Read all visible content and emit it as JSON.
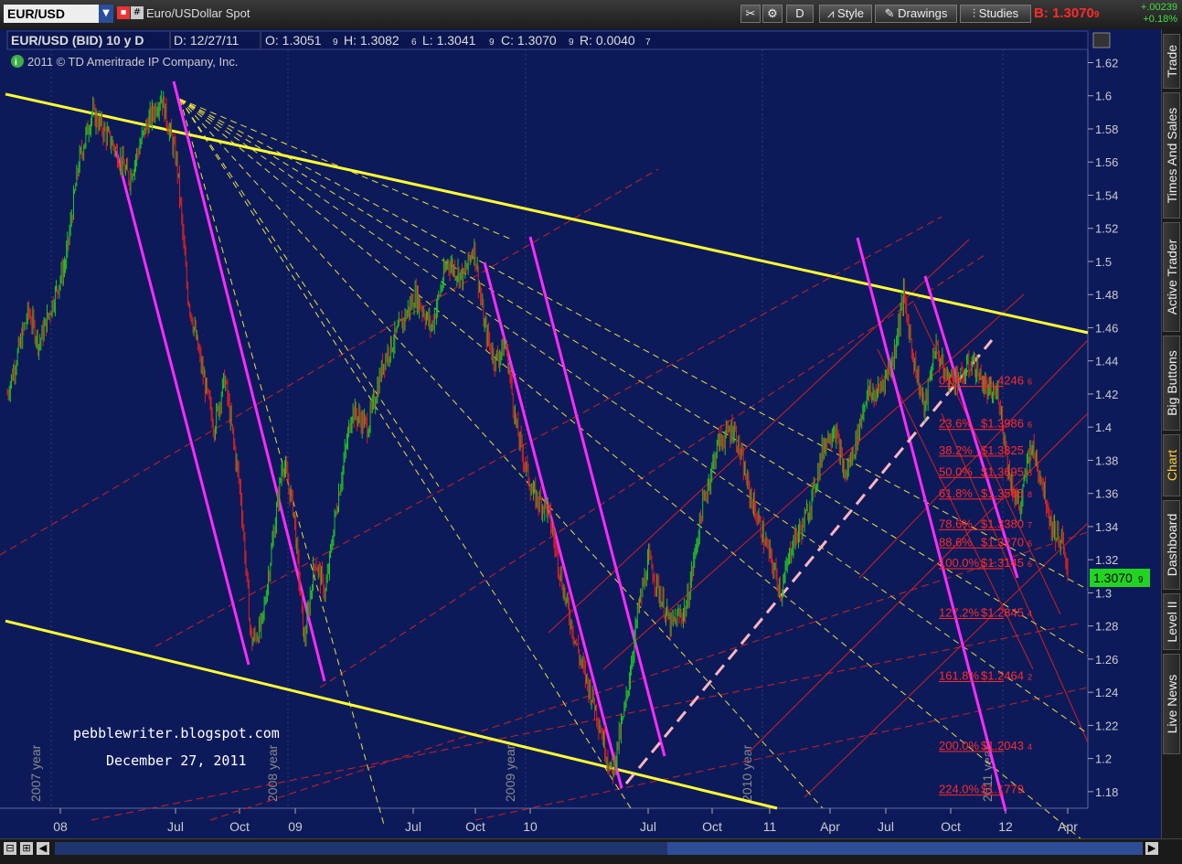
{
  "toolbar": {
    "symbol": "EUR/USD",
    "description": "Euro/USDollar Spot",
    "period_button": "D",
    "style_button": "Style",
    "drawings_button": "Drawings",
    "studies_button": "Studies",
    "bid_label": "B: 1.3070",
    "bid_last_digit": "9",
    "change": "+.00239",
    "change_pct": "+0.18%"
  },
  "header": {
    "instrument": "EUR/USD (BID) 10 y D",
    "date": "D: 12/27/11",
    "open": "O: 1.3051",
    "open_d": "9",
    "high": "H: 1.3082",
    "high_d": "6",
    "low": "L: 1.3041",
    "low_d": "9",
    "close": "C: 1.3070",
    "close_d": "9",
    "range": "R: 0.0040",
    "range_d": "7",
    "copyright": "2011 © TD Ameritrade IP Company, Inc."
  },
  "annotations": {
    "blog": "pebblewriter.blogspot.com",
    "date": "December 27, 2011"
  },
  "sidebar": {
    "tabs": [
      "Trade",
      "Times And Sales",
      "Active Trader",
      "Big Buttons",
      "Chart",
      "Dashboard",
      "Level II",
      "Live News"
    ],
    "active": "Chart"
  },
  "chart_data": {
    "type": "candlestick",
    "title": "EUR/USD (BID) 10 y D",
    "y_ticks": [
      1.18,
      1.2,
      1.22,
      1.24,
      1.26,
      1.28,
      1.3,
      1.32,
      1.34,
      1.36,
      1.38,
      1.4,
      1.42,
      1.44,
      1.46,
      1.48,
      1.5,
      1.52,
      1.54,
      1.56,
      1.58,
      1.6,
      1.62
    ],
    "ylim": [
      1.17,
      1.628
    ],
    "x_labels": [
      "08",
      "Jul",
      "Oct",
      "09",
      "Jul",
      "Oct",
      "10",
      "Jul",
      "Oct",
      "11",
      "Apr",
      "Jul",
      "Oct",
      "12",
      "Apr"
    ],
    "year_markers": [
      "2007 year",
      "2008 year",
      "2009 year",
      "2010 year",
      "2011 year"
    ],
    "current_price": "1.3070",
    "current_price_d": "9",
    "price_path": [
      [
        0,
        1.42
      ],
      [
        0.08,
        1.47
      ],
      [
        0.12,
        1.45
      ],
      [
        0.18,
        1.48
      ],
      [
        0.22,
        1.5
      ],
      [
        0.27,
        1.56
      ],
      [
        0.32,
        1.59
      ],
      [
        0.4,
        1.57
      ],
      [
        0.46,
        1.55
      ],
      [
        0.52,
        1.58
      ],
      [
        0.58,
        1.6
      ],
      [
        0.64,
        1.56
      ],
      [
        0.68,
        1.48
      ],
      [
        0.74,
        1.43
      ],
      [
        0.78,
        1.4
      ],
      [
        0.82,
        1.43
      ],
      [
        0.88,
        1.36
      ],
      [
        0.92,
        1.27
      ],
      [
        0.96,
        1.28
      ],
      [
        1.0,
        1.33
      ],
      [
        1.04,
        1.38
      ],
      [
        1.08,
        1.35
      ],
      [
        1.12,
        1.27
      ],
      [
        1.16,
        1.32
      ],
      [
        1.2,
        1.3
      ],
      [
        1.24,
        1.35
      ],
      [
        1.3,
        1.41
      ],
      [
        1.36,
        1.4
      ],
      [
        1.42,
        1.44
      ],
      [
        1.48,
        1.46
      ],
      [
        1.54,
        1.48
      ],
      [
        1.6,
        1.46
      ],
      [
        1.66,
        1.5
      ],
      [
        1.72,
        1.49
      ],
      [
        1.76,
        1.51
      ],
      [
        1.8,
        1.46
      ],
      [
        1.84,
        1.44
      ],
      [
        1.88,
        1.45
      ],
      [
        1.92,
        1.4
      ],
      [
        1.98,
        1.36
      ],
      [
        2.04,
        1.35
      ],
      [
        2.1,
        1.3
      ],
      [
        2.16,
        1.26
      ],
      [
        2.22,
        1.23
      ],
      [
        2.28,
        1.19
      ],
      [
        2.33,
        1.23
      ],
      [
        2.38,
        1.29
      ],
      [
        2.42,
        1.32
      ],
      [
        2.46,
        1.3
      ],
      [
        2.5,
        1.28
      ],
      [
        2.56,
        1.29
      ],
      [
        2.62,
        1.35
      ],
      [
        2.68,
        1.39
      ],
      [
        2.74,
        1.4
      ],
      [
        2.8,
        1.36
      ],
      [
        2.86,
        1.33
      ],
      [
        2.92,
        1.3
      ],
      [
        2.96,
        1.33
      ],
      [
        3.0,
        1.34
      ],
      [
        3.04,
        1.36
      ],
      [
        3.08,
        1.39
      ],
      [
        3.12,
        1.4
      ],
      [
        3.16,
        1.37
      ],
      [
        3.2,
        1.39
      ],
      [
        3.24,
        1.42
      ],
      [
        3.28,
        1.42
      ],
      [
        3.34,
        1.44
      ],
      [
        3.38,
        1.48
      ],
      [
        3.42,
        1.44
      ],
      [
        3.46,
        1.41
      ],
      [
        3.5,
        1.45
      ],
      [
        3.54,
        1.43
      ],
      [
        3.6,
        1.43
      ],
      [
        3.64,
        1.44
      ],
      [
        3.7,
        1.42
      ],
      [
        3.74,
        1.42
      ],
      [
        3.78,
        1.37
      ],
      [
        3.82,
        1.35
      ],
      [
        3.86,
        1.39
      ],
      [
        3.9,
        1.37
      ],
      [
        3.94,
        1.34
      ],
      [
        3.98,
        1.33
      ],
      [
        4.0,
        1.307
      ]
    ],
    "fibonacci": [
      {
        "pct": "0.0%",
        "price": "$1.4246",
        "d": "6",
        "value": 1.4246
      },
      {
        "pct": "23.6%",
        "price": "$1.3986",
        "d": "6",
        "value": 1.3986
      },
      {
        "pct": "38.2%",
        "price": "$1.3825",
        "d": "5",
        "value": 1.3825
      },
      {
        "pct": "50.0%",
        "price": "$1.3695",
        "d": "8",
        "value": 1.3696
      },
      {
        "pct": "61.8%",
        "price": "$1.3565",
        "d": "8",
        "value": 1.3566
      },
      {
        "pct": "78.6%",
        "price": "$1.3380",
        "d": "7",
        "value": 1.3381
      },
      {
        "pct": "88.6%",
        "price": "$1.3270",
        "d": "6",
        "value": 1.3271
      },
      {
        "pct": "100.0%",
        "price": "$1.3145",
        "d": "6",
        "value": 1.3146
      },
      {
        "pct": "127.2%",
        "price": "$1.2845",
        "d": "4",
        "value": 1.2845
      },
      {
        "pct": "161.8%",
        "price": "$1.2464",
        "d": "2",
        "value": 1.2464
      },
      {
        "pct": "200.0%",
        "price": "$1.2043",
        "d": "4",
        "value": 1.2043
      },
      {
        "pct": "224.0%",
        "price": "$1.1779",
        "d": "",
        "value": 1.1779
      }
    ],
    "colors": {
      "background": "#0d1a5a",
      "up_candle": "#22c322",
      "down_candle": "#e02020",
      "channel": "#ffff33",
      "fan": "#e8e040",
      "magenta_trend": "#ff2bff",
      "red_grid": "#d02020",
      "pink_dashed": "#ffb6c1",
      "fib": "#ff2a2a",
      "price_tag": "#22d422"
    }
  }
}
